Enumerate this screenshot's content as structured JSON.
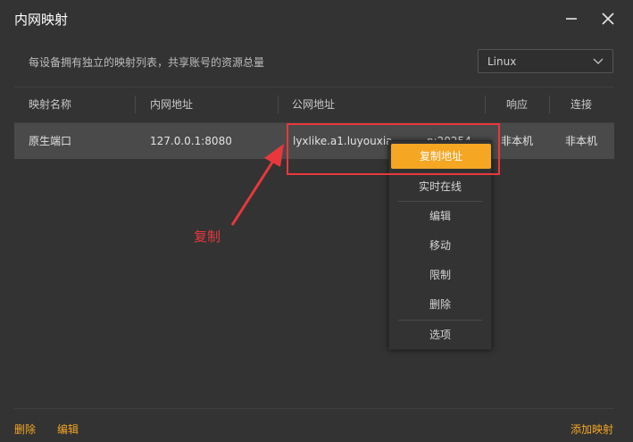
{
  "window": {
    "title": "内网映射"
  },
  "description": "每设备拥有独立的映射列表，共享账号的资源总量",
  "os_select": {
    "value": "Linux"
  },
  "table": {
    "headers": [
      "映射名称",
      "内网地址",
      "公网地址",
      "响应",
      "连接"
    ],
    "rows": [
      {
        "name": "原生端口",
        "local": "127.0.0.1:8080",
        "public_start": "lyxlike.a1.luyouxia.",
        "public_end": "n:20254",
        "response": "非本机",
        "connection": "非本机"
      }
    ]
  },
  "context_menu": {
    "items": [
      "复制地址",
      "实时在线",
      "编辑",
      "移动",
      "限制",
      "删除",
      "选项"
    ]
  },
  "annotation": "复制",
  "footer": {
    "delete": "删除",
    "edit": "编辑",
    "add": "添加映射"
  },
  "colors": {
    "accent": "#f5a623",
    "annotation": "#e8383d",
    "background": "#333333",
    "row_selected": "#4a4a4a"
  }
}
